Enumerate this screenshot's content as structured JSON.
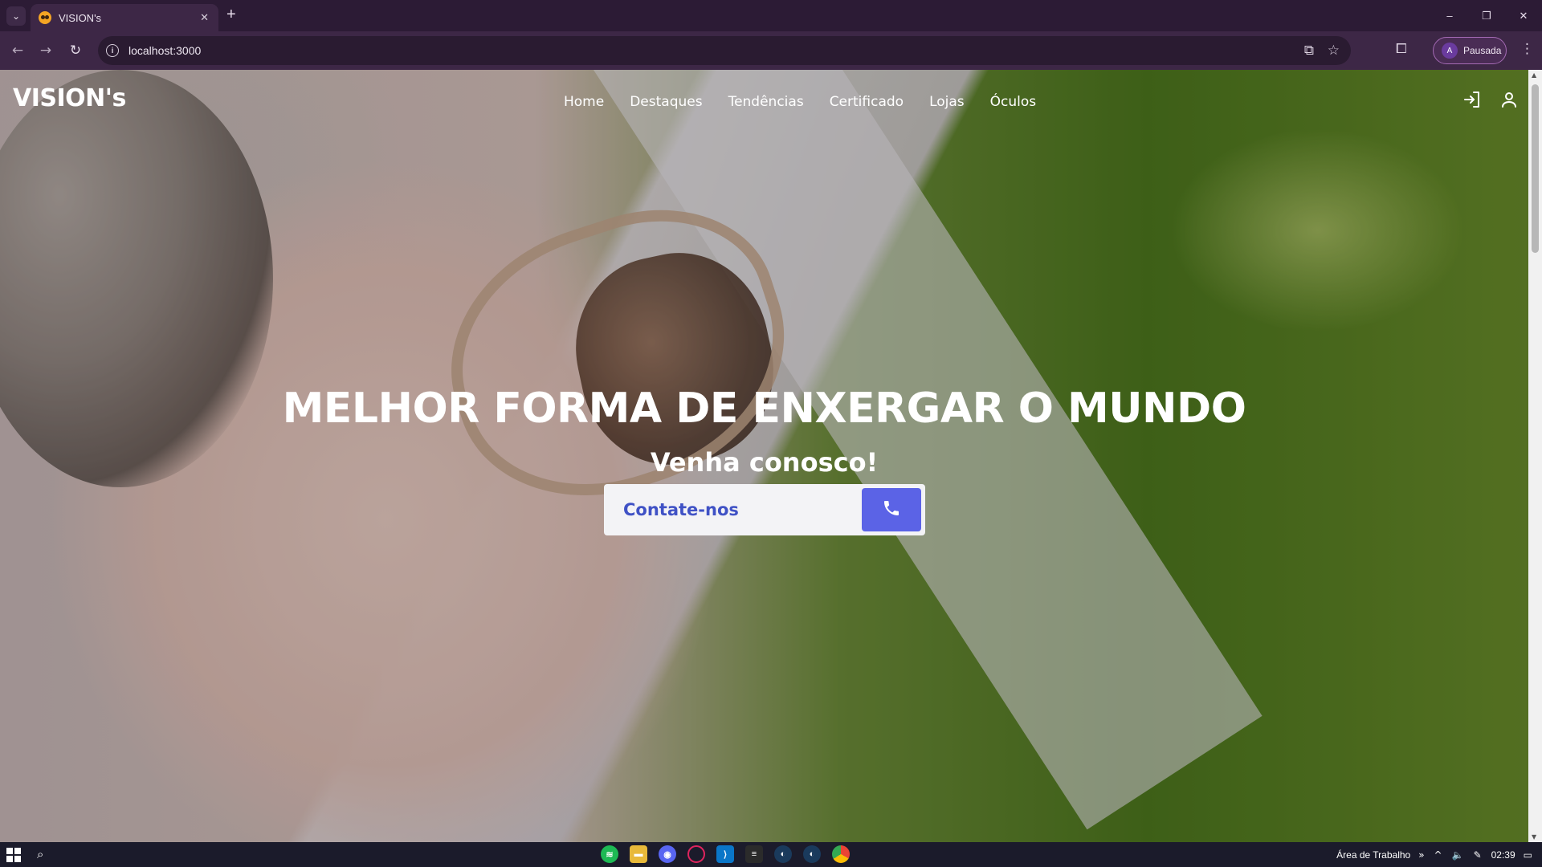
{
  "browser": {
    "tab_title": "VISION's",
    "new_tab_label": "+",
    "url": "localhost:3000",
    "profile_initial": "A",
    "profile_status": "Pausada",
    "window_controls": {
      "minimize": "–",
      "restore": "❐",
      "close": "✕"
    },
    "icons": [
      "tab-search-icon",
      "back-icon",
      "forward-icon",
      "reload-icon",
      "site-info-icon",
      "install-app-icon",
      "bookmark-star-icon",
      "extensions-icon",
      "menu-kebab-icon"
    ]
  },
  "site": {
    "logo": "VISION's",
    "nav": [
      "Home",
      "Destaques",
      "Tendências",
      "Certificado",
      "Lojas",
      "Óculos"
    ],
    "header_icons": [
      "login-icon",
      "user-icon"
    ],
    "hero": {
      "title": "MELHOR FORMA DE ENXERGAR O MUNDO",
      "subtitle": "Venha conosco!",
      "contact_label": "Contate-nos",
      "contact_icon": "phone-icon"
    }
  },
  "colors": {
    "browser_frame": "#2c1b35",
    "toolbar": "#3d2746",
    "accent_button": "#5b63e6",
    "contact_text": "#3f51c5",
    "taskbar": "#1b1b2b"
  },
  "taskbar": {
    "apps": [
      "spotify-icon",
      "file-explorer-icon",
      "discord-icon",
      "opera-gx-icon",
      "vscode-icon",
      "terminal-icon",
      "steam-icon",
      "steam-2-icon",
      "chrome-icon"
    ],
    "desktop_label": "Área de Trabalho",
    "time": "02:39"
  }
}
